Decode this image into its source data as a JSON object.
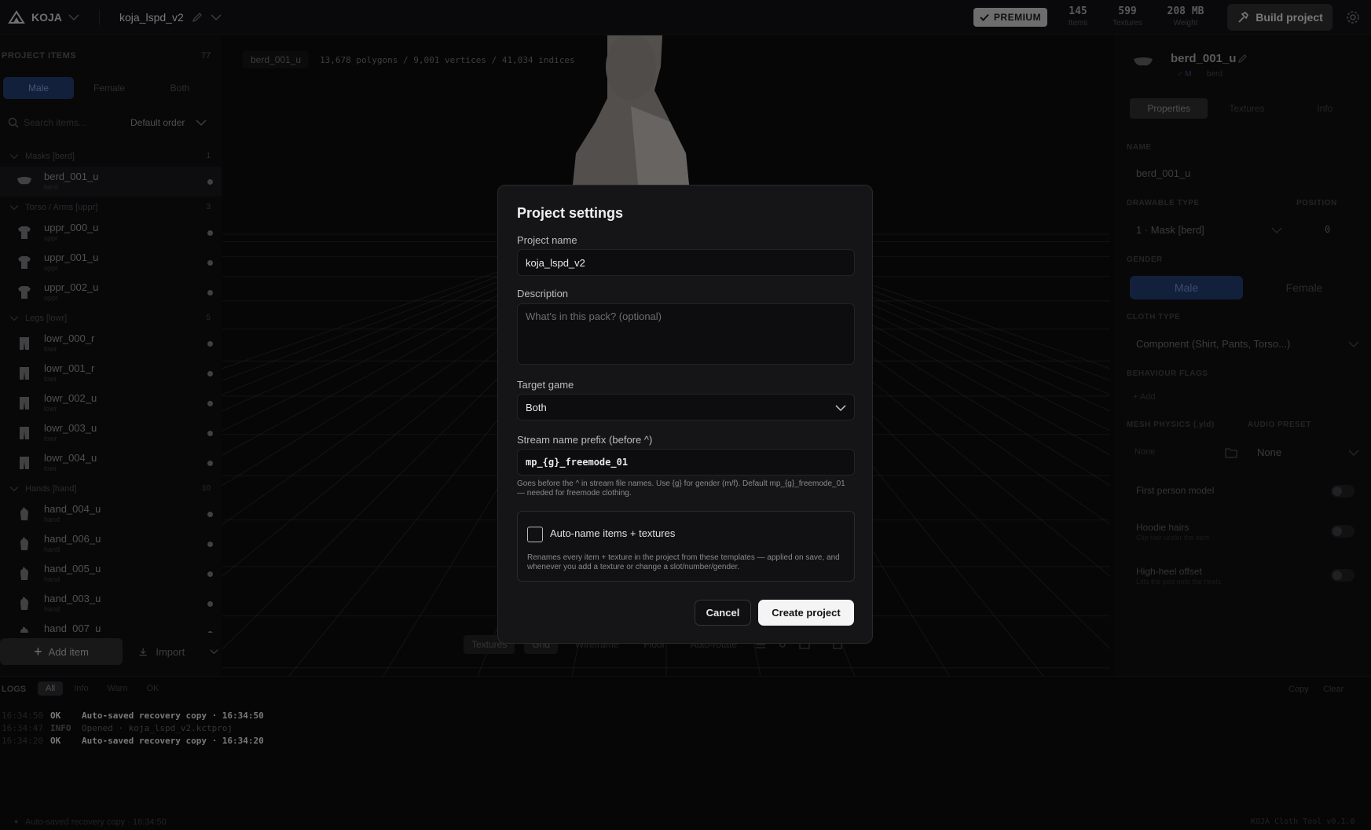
{
  "topbar": {
    "brand": "KOJA",
    "project_name": "koja_lspd_v2",
    "premium": "PREMIUM",
    "stats": [
      {
        "value": "145",
        "label": "Items"
      },
      {
        "value": "599",
        "label": "Textures"
      },
      {
        "value": "208 MB",
        "label": "Weight"
      }
    ],
    "build_label": "Build project"
  },
  "left": {
    "header": "PROJECT ITEMS",
    "count": "77",
    "gender_tabs": [
      "Male",
      "Female",
      "Both"
    ],
    "search_placeholder": "Search items...",
    "order": "Default order",
    "groups": [
      {
        "name": "Masks [berd]",
        "count": "1",
        "items": [
          {
            "name": "berd_001_u",
            "sub": "berd",
            "icon": "mask"
          }
        ]
      },
      {
        "name": "Torso / Arms [uppr]",
        "count": "3",
        "items": [
          {
            "name": "uppr_000_u",
            "sub": "uppr",
            "icon": "shirt"
          },
          {
            "name": "uppr_001_u",
            "sub": "uppr",
            "icon": "shirt"
          },
          {
            "name": "uppr_002_u",
            "sub": "uppr",
            "icon": "shirt"
          }
        ]
      },
      {
        "name": "Legs [lowr]",
        "count": "5",
        "items": [
          {
            "name": "lowr_000_r",
            "sub": "lowr",
            "icon": "pants"
          },
          {
            "name": "lowr_001_r",
            "sub": "lowr",
            "icon": "pants"
          },
          {
            "name": "lowr_002_u",
            "sub": "lowr",
            "icon": "pants"
          },
          {
            "name": "lowr_003_u",
            "sub": "lowr",
            "icon": "pants"
          },
          {
            "name": "lowr_004_u",
            "sub": "lowr",
            "icon": "pants"
          }
        ]
      },
      {
        "name": "Hands [hand]",
        "count": "10",
        "items": [
          {
            "name": "hand_004_u",
            "sub": "hand",
            "icon": "hand"
          },
          {
            "name": "hand_006_u",
            "sub": "hand",
            "icon": "hand"
          },
          {
            "name": "hand_005_u",
            "sub": "hand",
            "icon": "hand"
          },
          {
            "name": "hand_003_u",
            "sub": "hand",
            "icon": "hand"
          },
          {
            "name": "hand_007_u",
            "sub": "hand",
            "icon": "hand"
          }
        ]
      }
    ],
    "add_item": "Add item",
    "import": "Import"
  },
  "viewport": {
    "mesh_name": "berd_001_u",
    "mesh_info": "13,678 polygons / 9,001 vertices / 41,034 indices",
    "tools": [
      "Textures",
      "Grid",
      "Wireframe",
      "Floor",
      "Auto-rotate"
    ]
  },
  "right": {
    "item_name": "berd_001_u",
    "item_gender": "♂ M",
    "item_slot": "berd",
    "tabs": [
      "Properties",
      "Textures",
      "Info"
    ],
    "name_label": "NAME",
    "name_value": "berd_001_u",
    "drawable_label": "DRAWABLE TYPE",
    "drawable_value": "1 · Mask [berd]",
    "position_label": "POSITION",
    "position_value": "0",
    "gender_label": "GENDER",
    "gender_options": [
      "Male",
      "Female"
    ],
    "cloth_label": "CLOTH TYPE",
    "cloth_value": "Component (Shirt, Pants, Torso...)",
    "flags_label": "BEHAVIOUR FLAGS",
    "flags_add": "+ Add",
    "physics_label": "MESH PHYSICS (.yld)",
    "physics_value": "None",
    "audio_label": "AUDIO PRESET",
    "audio_value": "None",
    "toggles": [
      {
        "label": "First person model",
        "sub": ""
      },
      {
        "label": "Hoodie hairs",
        "sub": "Clip hair under the item"
      },
      {
        "label": "High-heel offset",
        "sub": "Lifts the ped onto the heels"
      }
    ]
  },
  "logs": {
    "label": "LOGS",
    "tabs": [
      "All",
      "Info",
      "Warn",
      "OK"
    ],
    "copy": "Copy",
    "clear": "Clear",
    "lines": [
      {
        "ts": "16:34:50",
        "level": "OK",
        "msg": "Auto-saved recovery copy · 16:34:50",
        "color": "#cfcfd2"
      },
      {
        "ts": "16:34:47",
        "level": "INFO",
        "msg": "Opened · koja_lspd_v2.kctproj",
        "color": "#5a5a5e"
      },
      {
        "ts": "16:34:20",
        "level": "OK",
        "msg": "Auto-saved recovery copy · 16:34:20",
        "color": "#cfcfd2"
      }
    ]
  },
  "status": {
    "message": "Auto-saved recovery copy · 16:34:50",
    "version": "KOJA Cloth Tool v0.1.0"
  },
  "modal": {
    "title": "Project settings",
    "project_name_label": "Project name",
    "project_name_value": "koja_lspd_v2",
    "description_label": "Description",
    "description_placeholder": "What's in this pack? (optional)",
    "target_game_label": "Target game",
    "target_game_value": "Both",
    "prefix_label": "Stream name prefix (before ^)",
    "prefix_value": "mp_{g}_freemode_01",
    "prefix_hint": "Goes before the ^ in stream file names. Use {g} for gender (m/f). Default mp_{g}_freemode_01 — needed for freemode clothing.",
    "autoname_label": "Auto-name items + textures",
    "autoname_desc": "Renames every item + texture in the project from these templates — applied on save, and whenever you add a texture or change a slot/number/gender.",
    "cancel": "Cancel",
    "create": "Create project"
  },
  "colors": {
    "accent_blue": "#1f3768",
    "primary_button": "#f4f4f5",
    "background": "#0b0b0c"
  }
}
